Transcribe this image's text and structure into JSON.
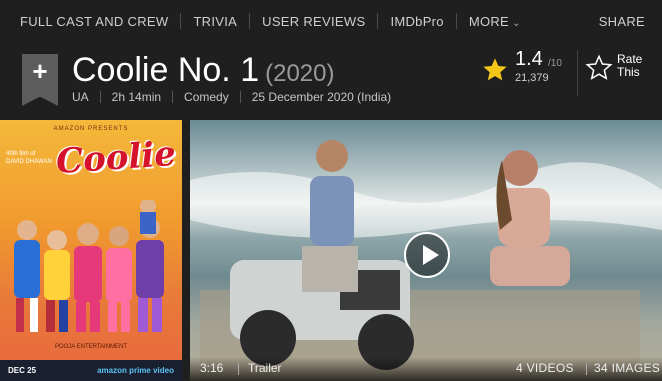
{
  "nav": {
    "full_cast": "FULL CAST AND CREW",
    "trivia": "TRIVIA",
    "user_reviews": "USER REVIEWS",
    "imdbpro": "IMDbPro",
    "more": "MORE",
    "share": "SHARE"
  },
  "title": {
    "name": "Coolie No. 1",
    "year": "(2020)",
    "certificate": "UA",
    "runtime": "2h 14min",
    "genre": "Comedy",
    "release": "25 December 2020 (India)"
  },
  "rating": {
    "value": "1.4",
    "max": "/10",
    "count": "21,379",
    "rate_label": "Rate This"
  },
  "poster": {
    "presents": "AMAZON PRESENTS",
    "director": "40th film of DAVID DHAWAN",
    "logo": "Coolie",
    "tagline": "POOJA ENTERTAINMENT",
    "date": "DEC 25",
    "service": "amazon prime video"
  },
  "video": {
    "duration": "3:16",
    "type": "Trailer",
    "videos": "4 VIDEOS",
    "images": "34 IMAGES"
  },
  "colors": {
    "star": "#f5c518",
    "background": "#1f1f1f"
  }
}
